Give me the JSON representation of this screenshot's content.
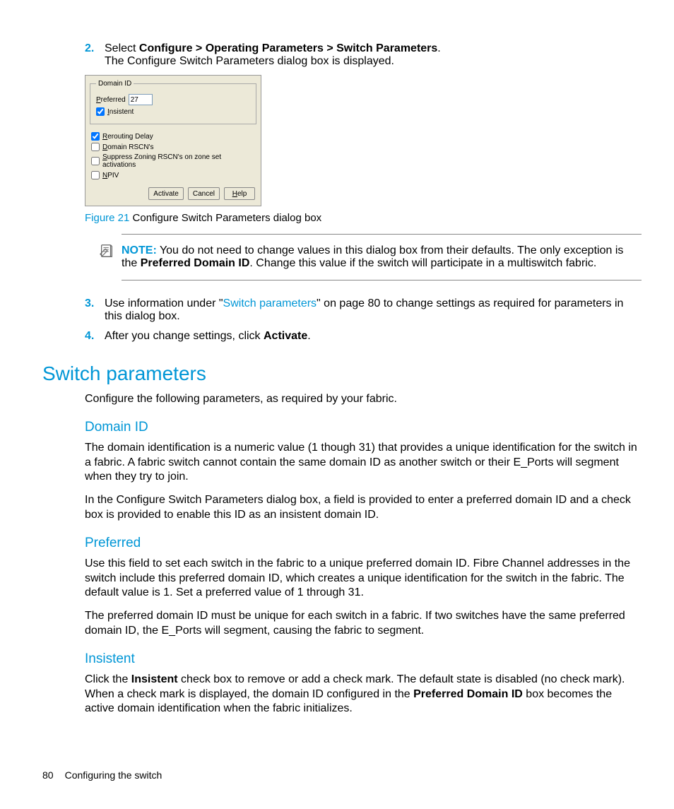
{
  "steps_top": {
    "step2_num": "2.",
    "step2_a": "Select ",
    "step2_b": "Configure > Operating Parameters > Switch Parameters",
    "step2_c": ".",
    "step2_line2": "The Configure Switch Parameters dialog box is displayed."
  },
  "dialog": {
    "legend": "Domain ID",
    "preferred_label_first": "P",
    "preferred_label_rest": "referred",
    "preferred_value": "27",
    "insistent_first": "I",
    "insistent_rest": "nsistent",
    "rerouting_first": "R",
    "rerouting_rest": "erouting Delay",
    "rscn_first": "D",
    "rscn_rest": "omain RSCN's",
    "suppress_first": "S",
    "suppress_rest": "uppress Zoning RSCN's on zone set activations",
    "npiv_first": "N",
    "npiv_rest": "PIV",
    "btn_activate": "Activate",
    "btn_cancel": "Cancel",
    "btn_help_first": "H",
    "btn_help_rest": "elp"
  },
  "figure": {
    "num": "Figure 21",
    "text": " Configure Switch Parameters dialog box"
  },
  "note": {
    "label": "NOTE:",
    "text_a": "   You do not need to change values in this dialog box from their defaults. The only exception is the ",
    "text_b": "Preferred Domain ID",
    "text_c": ". Change this value if the switch will participate in a multiswitch fabric."
  },
  "steps_bottom": {
    "step3_num": "3.",
    "step3_a": "Use information under \"",
    "step3_link": "Switch parameters",
    "step3_b": "\" on page 80 to change settings as required for parameters in this dialog box.",
    "step4_num": "4.",
    "step4_a": "After you change settings, click ",
    "step4_b": "Activate",
    "step4_c": "."
  },
  "section": {
    "h2": "Switch parameters",
    "intro": "Configure the following parameters, as required by your fabric.",
    "domain_h": "Domain ID",
    "domain_p1": "The domain identification is a numeric value (1 though 31) that provides a unique identification for the switch in a fabric. A fabric switch cannot contain the same domain ID as another switch or their E_Ports will segment when they try to join.",
    "domain_p2": "In the Configure Switch Parameters dialog box, a field is provided to enter a preferred domain ID and a check box is provided to enable this ID as an insistent domain ID.",
    "pref_h": "Preferred",
    "pref_p1": "Use this field to set each switch in the fabric to a unique preferred domain ID. Fibre Channel addresses in the switch include this preferred domain ID, which creates a unique identification for the switch in the fabric. The default value is 1. Set a preferred value of 1 through 31.",
    "pref_p2": "The preferred domain ID must be unique for each switch in a fabric. If two switches have the same preferred domain ID, the E_Ports will segment, causing the fabric to segment.",
    "ins_h": "Insistent",
    "ins_a": "Click the ",
    "ins_b": "Insistent",
    "ins_c": " check box to remove or add a check mark. The default state is disabled (no check mark). When a check mark is displayed, the domain ID configured in the ",
    "ins_d": "Preferred Domain ID",
    "ins_e": " box becomes the active domain identification when the fabric initializes."
  },
  "footer": {
    "page": "80",
    "title": "Configuring the switch"
  }
}
